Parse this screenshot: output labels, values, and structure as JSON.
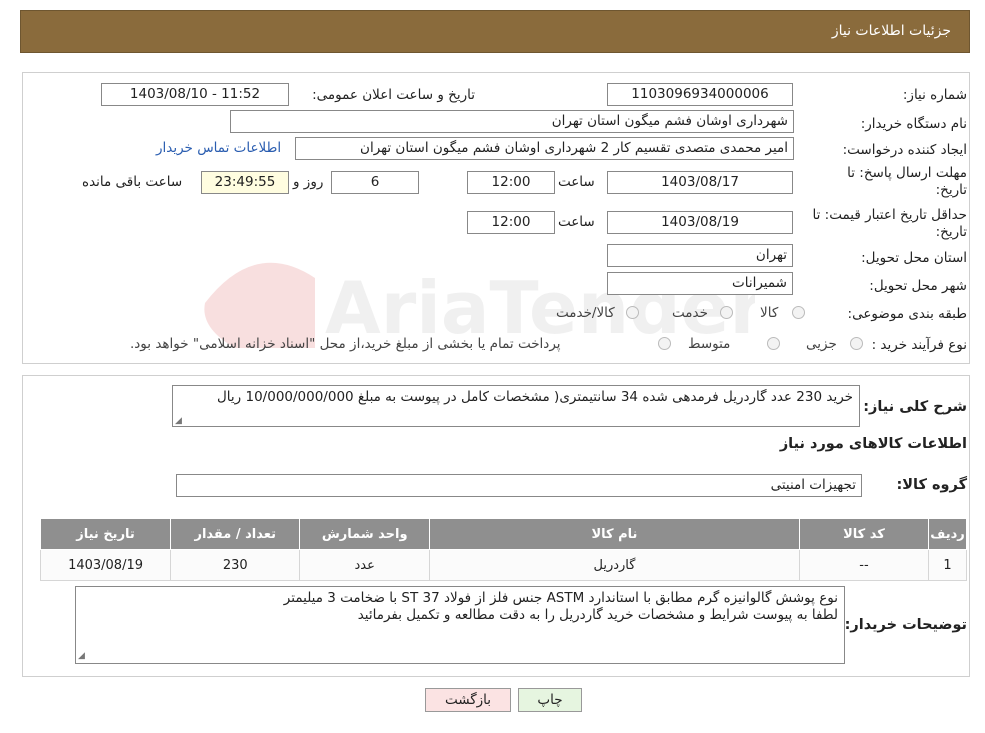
{
  "header": {
    "title": "جزئیات اطلاعات نیاز"
  },
  "watermark": {
    "text": "AriaTender.neT"
  },
  "form": {
    "need_number_label": "شماره نیاز:",
    "need_number": "1103096934000006",
    "announce_label": "تاریخ و ساعت اعلان عمومی:",
    "announce_value": "1403/08/10 - 11:52",
    "buyer_org_label": "نام دستگاه خریدار:",
    "buyer_org": "شهرداری اوشان فشم میگون استان تهران",
    "requester_label": "ایجاد کننده درخواست:",
    "requester": "امیر محمدی متصدی تقسیم کار 2 شهرداری اوشان فشم میگون استان تهران",
    "contact_link": "اطلاعات تماس خریدار",
    "deadline_label_1": "مهلت ارسال پاسخ: تا",
    "deadline_label_2": "تاریخ:",
    "deadline_date": "1403/08/17",
    "time_word": "ساعت",
    "deadline_time": "12:00",
    "days_value": "6",
    "days_word": "روز و",
    "remaining_time": "23:49:55",
    "remaining_word": "ساعت باقی مانده",
    "validity_label_1": "حداقل تاریخ اعتبار قیمت: تا",
    "validity_label_2": "تاریخ:",
    "validity_date": "1403/08/19",
    "validity_time": "12:00",
    "province_label": "استان محل تحویل:",
    "province": "تهران",
    "city_label": "شهر محل تحویل:",
    "city": "شمیرانات",
    "category_label": "طبقه بندی موضوعی:",
    "category_options": [
      "کالا",
      "خدمت",
      "کالا/خدمت"
    ],
    "process_label": "نوع فرآیند خرید :",
    "process_options": [
      "جزیی",
      "متوسط"
    ],
    "process_note": "پرداخت تمام یا بخشی از مبلغ خرید،از محل \"اسناد خزانه اسلامی\" خواهد بود."
  },
  "details": {
    "description_label": "شرح کلی نیاز:",
    "description": "خرید 230 عدد گاردریل فرمدهی شده 34 سانتیمتری( مشخصات کامل در پیوست به مبلغ 10/000/000/000 ریال",
    "goods_info_title": "اطلاعات کالاهای مورد نیاز",
    "goods_group_label": "گروه کالا:",
    "goods_group": "تجهیزات امنیتی",
    "table": {
      "headers": [
        "ردیف",
        "کد کالا",
        "نام کالا",
        "واحد شمارش",
        "تعداد / مقدار",
        "تاریخ نیاز"
      ],
      "rows": [
        [
          "1",
          "--",
          "گاردریل",
          "عدد",
          "230",
          "1403/08/19"
        ]
      ]
    },
    "buyer_notes_label": "توضیحات خریدار:",
    "buyer_notes_line1": "نوع پوشش گالوانیزه گرم مطابق با استاندارد ASTM جنس فلز از فولاد ST 37 با ضخامت 3 میلیمتر",
    "buyer_notes_line2": "لطفا به پیوست شرایط و مشخصات خرید گاردریل را به دقت مطالعه و تکمیل بفرمائید"
  },
  "buttons": {
    "print": "چاپ",
    "back": "بازگشت"
  },
  "colors": {
    "header_bg": "#8a6b3c",
    "table_header_bg": "#8f8f8f",
    "back_btn_bg": "#fbe3e3",
    "print_btn_bg": "#e6f5e0"
  }
}
